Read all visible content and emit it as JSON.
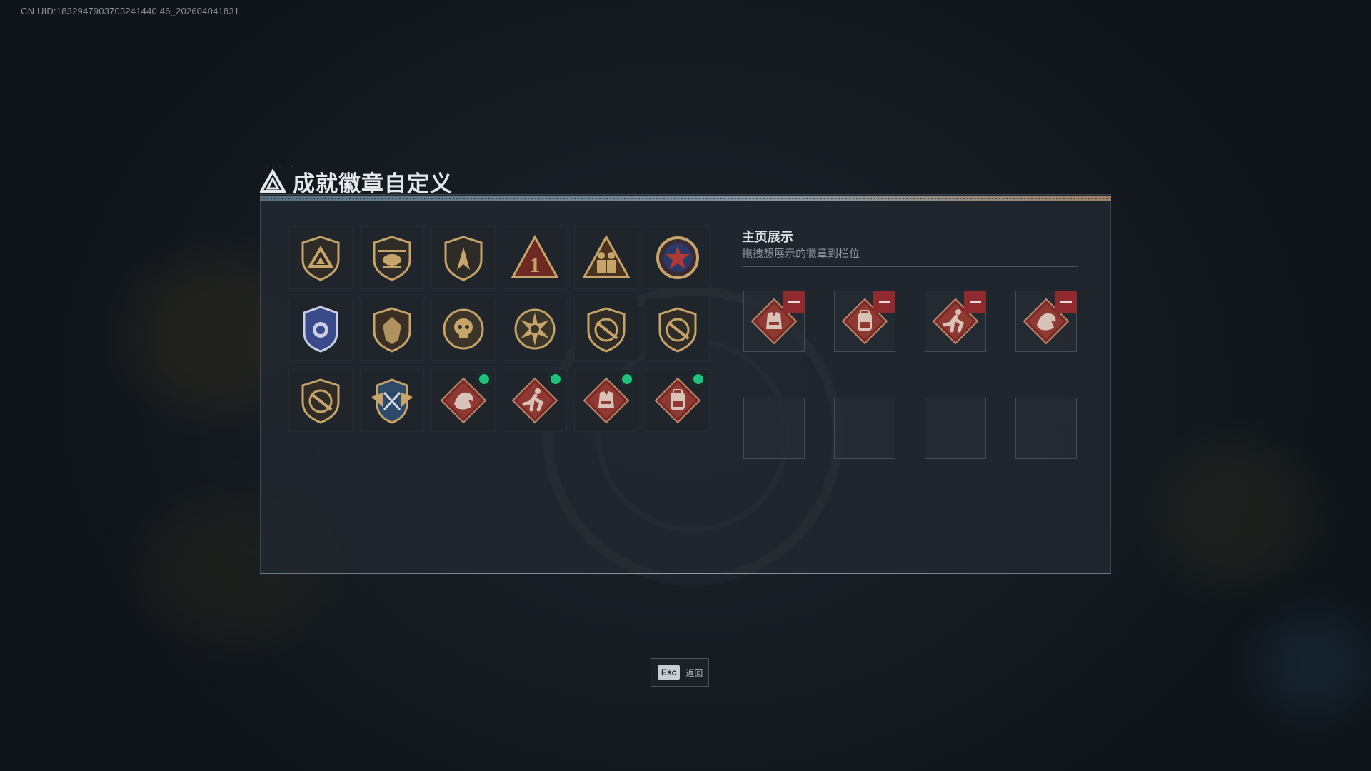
{
  "uid_text": "CN UID:1832947903703241440 46_202604041831",
  "title": "成就徽章自定义",
  "showcase": {
    "title": "主页展示",
    "subtitle": "拖拽想展示的徽章到栏位"
  },
  "badges": [
    {
      "icon": "triangle-shield-badge-icon",
      "new": false
    },
    {
      "icon": "helicopter-shield-badge-icon",
      "new": false
    },
    {
      "icon": "arrowhead-shield-badge-icon",
      "new": false
    },
    {
      "icon": "number-1-triangle-badge-icon",
      "new": false
    },
    {
      "icon": "soldiers-triangle-badge-icon",
      "new": false
    },
    {
      "icon": "star-medal-badge-icon",
      "new": false
    },
    {
      "icon": "police-shield-badge-icon",
      "new": false
    },
    {
      "icon": "heraldic-shield-badge-icon",
      "new": false
    },
    {
      "icon": "skull-emblem-badge-icon",
      "new": false
    },
    {
      "icon": "sunburst-emblem-badge-icon",
      "new": false
    },
    {
      "icon": "rifle-shield-badge-icon",
      "new": false
    },
    {
      "icon": "rifle-shield-badge-icon",
      "new": false
    },
    {
      "icon": "rifle-shield-badge-icon",
      "new": false
    },
    {
      "icon": "winged-crest-badge-icon",
      "new": false
    },
    {
      "icon": "dragon-diamond-badge-icon",
      "new": true
    },
    {
      "icon": "runner-diamond-badge-icon",
      "new": true
    },
    {
      "icon": "vest-diamond-badge-icon",
      "new": true
    },
    {
      "icon": "backpack-diamond-badge-icon",
      "new": true
    }
  ],
  "slots": [
    {
      "icon": "vest-diamond-badge-icon",
      "filled": true
    },
    {
      "icon": "backpack-diamond-badge-icon",
      "filled": true
    },
    {
      "icon": "runner-diamond-badge-icon",
      "filled": true
    },
    {
      "icon": "dragon-diamond-badge-icon",
      "filled": true
    },
    {
      "icon": "",
      "filled": false
    },
    {
      "icon": "",
      "filled": false
    },
    {
      "icon": "",
      "filled": false
    },
    {
      "icon": "",
      "filled": false
    }
  ],
  "esc": {
    "key": "Esc",
    "label": "返回"
  },
  "colors": {
    "accent_green": "#1fc27a",
    "remove_red": "#8f2b2e",
    "badge_gold": "#c7a46a"
  }
}
